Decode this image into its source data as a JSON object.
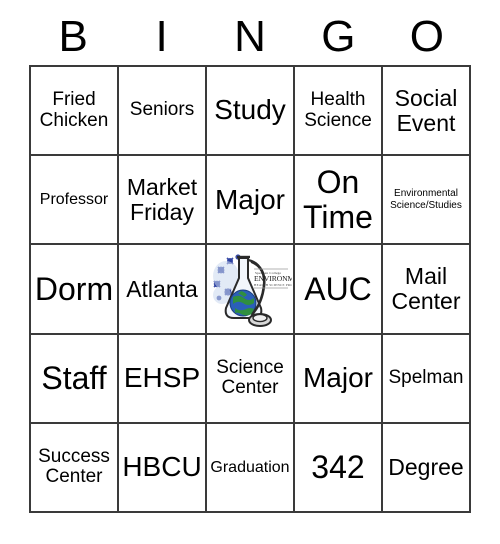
{
  "card": {
    "header_letters": [
      "B",
      "I",
      "N",
      "G",
      "O"
    ],
    "rows": [
      [
        {
          "text": "Fried\nChicken",
          "size": "md"
        },
        {
          "text": "Seniors",
          "size": "md"
        },
        {
          "text": "Study",
          "size": "xl"
        },
        {
          "text": "Health\nScience",
          "size": "md"
        },
        {
          "text": "Social\nEvent",
          "size": "lg"
        }
      ],
      [
        {
          "text": "Professor",
          "size": "sm"
        },
        {
          "text": "Market\nFriday",
          "size": "lg"
        },
        {
          "text": "Major",
          "size": "xl"
        },
        {
          "text": "On\nTime",
          "size": "xxl"
        },
        {
          "text": "Environmental\nScience/Studies",
          "size": "xs"
        }
      ],
      [
        {
          "text": "Dorm",
          "size": "xxl"
        },
        {
          "text": "Atlanta",
          "size": "lg"
        },
        {
          "text": "",
          "size": "md",
          "icon": "environmental-science-logo"
        },
        {
          "text": "AUC",
          "size": "xxl"
        },
        {
          "text": "Mail\nCenter",
          "size": "lg"
        }
      ],
      [
        {
          "text": "Staff",
          "size": "xxl"
        },
        {
          "text": "EHSP",
          "size": "xl"
        },
        {
          "text": "Science\nCenter",
          "size": "md"
        },
        {
          "text": "Major",
          "size": "xl"
        },
        {
          "text": "Spelman",
          "size": "md"
        }
      ],
      [
        {
          "text": "Success\nCenter",
          "size": "md"
        },
        {
          "text": "HBCU",
          "size": "xl"
        },
        {
          "text": "Graduation",
          "size": "sm"
        },
        {
          "text": "342",
          "size": "xxl"
        },
        {
          "text": "Degree",
          "size": "lg"
        }
      ]
    ],
    "logo": {
      "name": "environmental-science-logo",
      "primary_text": "ENVIRONMENTAL",
      "top_text": "Spelman College",
      "sub_text": "HEALTH SCIENCE PROGRAM",
      "colors": {
        "molecule_blue": "#2b3fa0",
        "globe_green": "#2f8f3f",
        "globe_blue": "#2b5fb8",
        "outline": "#2a2a2a",
        "flask_tint": "#e8eef8"
      }
    },
    "colors": {
      "background": "#ffffff",
      "border": "#3a3a3a",
      "text": "#000000"
    }
  }
}
